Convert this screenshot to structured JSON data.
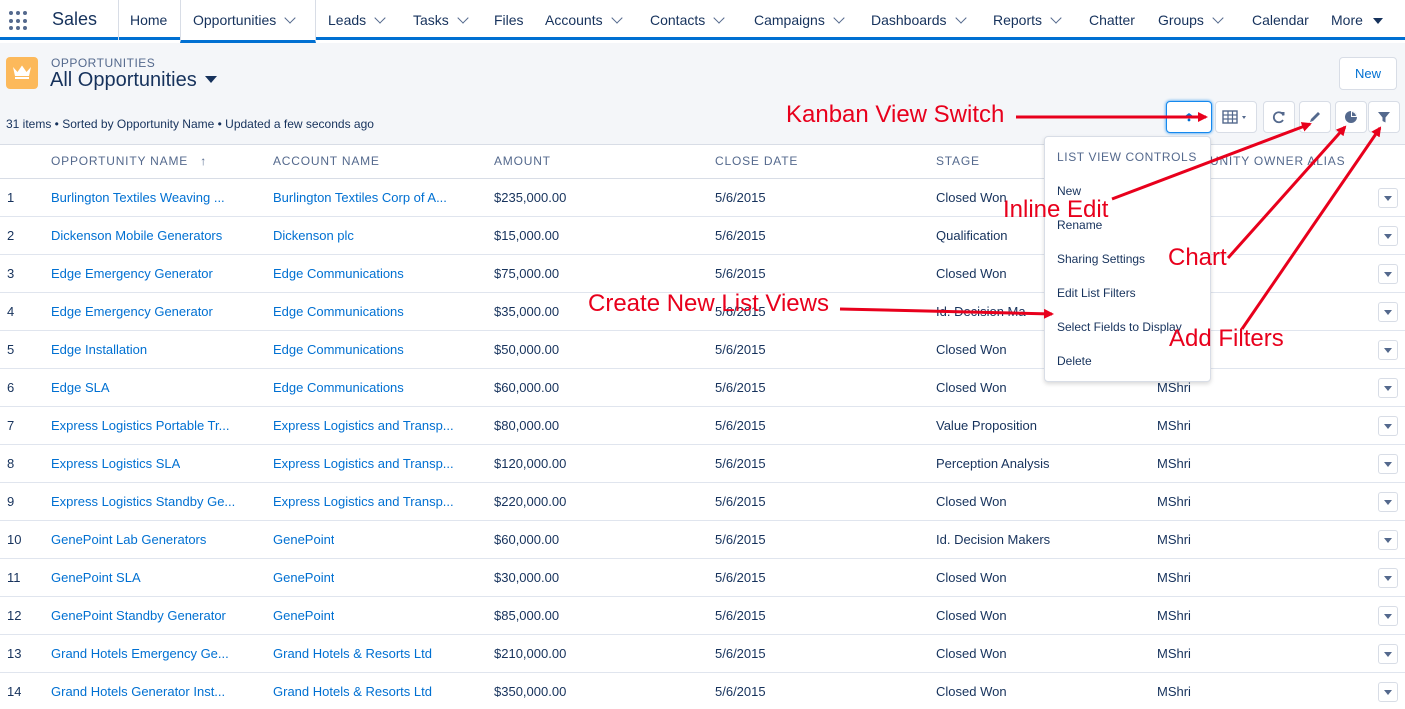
{
  "app": {
    "name": "Sales"
  },
  "nav": {
    "items": [
      {
        "label": "Home"
      },
      {
        "label": "Opportunities"
      },
      {
        "label": "Leads"
      },
      {
        "label": "Tasks"
      },
      {
        "label": "Files"
      },
      {
        "label": "Accounts"
      },
      {
        "label": "Contacts"
      },
      {
        "label": "Campaigns"
      },
      {
        "label": "Dashboards"
      },
      {
        "label": "Reports"
      },
      {
        "label": "Chatter"
      },
      {
        "label": "Groups"
      },
      {
        "label": "Calendar"
      },
      {
        "label": "More"
      }
    ]
  },
  "header": {
    "object_label": "OPPORTUNITIES",
    "view_title": "All Opportunities",
    "new_button": "New",
    "meta": "31 items • Sorted by Opportunity Name • Updated a few seconds ago"
  },
  "table": {
    "columns": [
      "OPPORTUNITY NAME",
      "ACCOUNT NAME",
      "AMOUNT",
      "CLOSE DATE",
      "STAGE",
      "UNITY OWNER ALIAS"
    ],
    "rows": [
      {
        "num": "1",
        "name": "Burlington Textiles Weaving ...",
        "account": "Burlington Textiles Corp of A...",
        "amount": "$235,000.00",
        "close": "5/6/2015",
        "stage": "Closed Won",
        "owner": ""
      },
      {
        "num": "2",
        "name": "Dickenson Mobile Generators",
        "account": "Dickenson plc",
        "amount": "$15,000.00",
        "close": "5/6/2015",
        "stage": "Qualification",
        "owner": ""
      },
      {
        "num": "3",
        "name": "Edge Emergency Generator",
        "account": "Edge Communications",
        "amount": "$75,000.00",
        "close": "5/6/2015",
        "stage": "Closed Won",
        "owner": ""
      },
      {
        "num": "4",
        "name": "Edge Emergency Generator",
        "account": "Edge Communications",
        "amount": "$35,000.00",
        "close": "5/6/2015",
        "stage": "Id. Decision Ma",
        "owner": ""
      },
      {
        "num": "5",
        "name": "Edge Installation",
        "account": "Edge Communications",
        "amount": "$50,000.00",
        "close": "5/6/2015",
        "stage": "Closed Won",
        "owner": ""
      },
      {
        "num": "6",
        "name": "Edge SLA",
        "account": "Edge Communications",
        "amount": "$60,000.00",
        "close": "5/6/2015",
        "stage": "Closed Won",
        "owner": "MShri"
      },
      {
        "num": "7",
        "name": "Express Logistics Portable Tr...",
        "account": "Express Logistics and Transp...",
        "amount": "$80,000.00",
        "close": "5/6/2015",
        "stage": "Value Proposition",
        "owner": "MShri"
      },
      {
        "num": "8",
        "name": "Express Logistics SLA",
        "account": "Express Logistics and Transp...",
        "amount": "$120,000.00",
        "close": "5/6/2015",
        "stage": "Perception Analysis",
        "owner": "MShri"
      },
      {
        "num": "9",
        "name": "Express Logistics Standby Ge...",
        "account": "Express Logistics and Transp...",
        "amount": "$220,000.00",
        "close": "5/6/2015",
        "stage": "Closed Won",
        "owner": "MShri"
      },
      {
        "num": "10",
        "name": "GenePoint Lab Generators",
        "account": "GenePoint",
        "amount": "$60,000.00",
        "close": "5/6/2015",
        "stage": "Id. Decision Makers",
        "owner": "MShri"
      },
      {
        "num": "11",
        "name": "GenePoint SLA",
        "account": "GenePoint",
        "amount": "$30,000.00",
        "close": "5/6/2015",
        "stage": "Closed Won",
        "owner": "MShri"
      },
      {
        "num": "12",
        "name": "GenePoint Standby Generator",
        "account": "GenePoint",
        "amount": "$85,000.00",
        "close": "5/6/2015",
        "stage": "Closed Won",
        "owner": "MShri"
      },
      {
        "num": "13",
        "name": "Grand Hotels Emergency Ge...",
        "account": "Grand Hotels & Resorts Ltd",
        "amount": "$210,000.00",
        "close": "5/6/2015",
        "stage": "Closed Won",
        "owner": "MShri"
      },
      {
        "num": "14",
        "name": "Grand Hotels Generator Inst...",
        "account": "Grand Hotels & Resorts Ltd",
        "amount": "$350,000.00",
        "close": "5/6/2015",
        "stage": "Closed Won",
        "owner": "MShri"
      }
    ]
  },
  "dropdown": {
    "header": "LIST VIEW CONTROLS",
    "items": [
      "New",
      "Rename",
      "Sharing Settings",
      "Edit List Filters",
      "Select Fields to Display",
      "Delete"
    ]
  },
  "annotations": {
    "kanban": "Kanban View Switch",
    "inline_edit": "Inline Edit",
    "chart": "Chart",
    "create_views": "Create New List Views",
    "add_filters": "Add Filters"
  },
  "colors": {
    "brand": "#0070d2",
    "annotation": "#e8001c",
    "object_icon": "#fcb95b"
  },
  "icons": {
    "app_launcher": "grid-icon",
    "object": "crown-icon",
    "display_toggle": "table-icon",
    "refresh": "refresh-icon",
    "edit": "pencil-icon",
    "chart": "pie-chart-icon",
    "filter": "filter-icon"
  }
}
